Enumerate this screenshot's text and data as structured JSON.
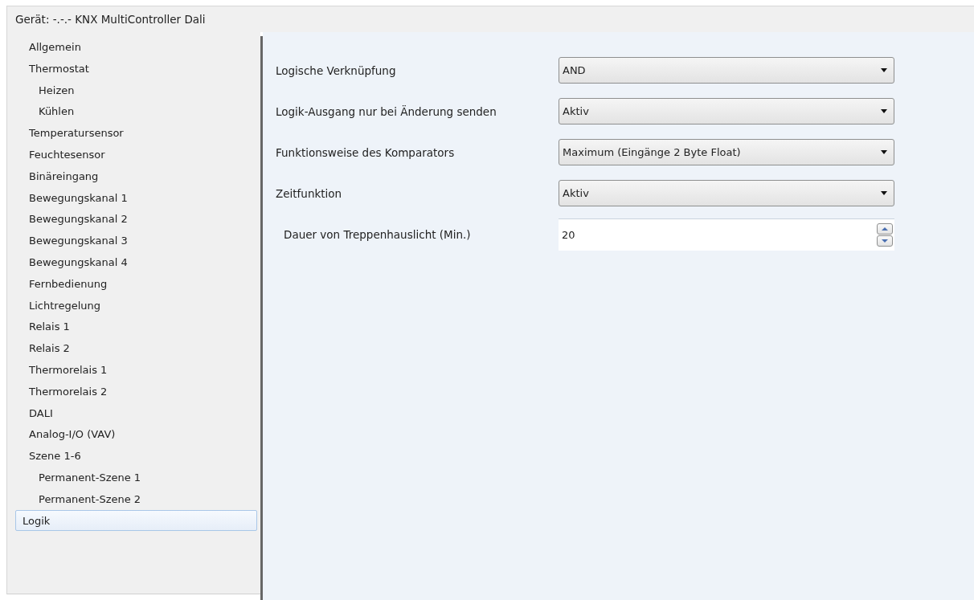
{
  "window": {
    "title": "Gerät: -.-.-  KNX MultiController Dali"
  },
  "sidebar": {
    "items": [
      {
        "label": "Allgemein",
        "selected": false
      },
      {
        "label": "Thermostat",
        "selected": false,
        "children": [
          {
            "label": "Heizen",
            "selected": false
          },
          {
            "label": "Kühlen",
            "selected": false
          }
        ]
      },
      {
        "label": "Temperatursensor",
        "selected": false
      },
      {
        "label": "Feuchtesensor",
        "selected": false
      },
      {
        "label": "Binäreingang",
        "selected": false
      },
      {
        "label": "Bewegungskanal 1",
        "selected": false
      },
      {
        "label": "Bewegungskanal 2",
        "selected": false
      },
      {
        "label": "Bewegungskanal 3",
        "selected": false
      },
      {
        "label": "Bewegungskanal 4",
        "selected": false
      },
      {
        "label": "Fernbedienung",
        "selected": false
      },
      {
        "label": "Lichtregelung",
        "selected": false
      },
      {
        "label": "Relais 1",
        "selected": false
      },
      {
        "label": "Relais 2",
        "selected": false
      },
      {
        "label": "Thermorelais 1",
        "selected": false
      },
      {
        "label": "Thermorelais 2",
        "selected": false
      },
      {
        "label": "DALI",
        "selected": false
      },
      {
        "label": "Analog-I/O (VAV)",
        "selected": false
      },
      {
        "label": "Szene 1-6",
        "selected": false,
        "children": [
          {
            "label": "Permanent-Szene 1",
            "selected": false
          },
          {
            "label": "Permanent-Szene 2",
            "selected": false
          }
        ]
      },
      {
        "label": "Logik",
        "selected": true
      }
    ]
  },
  "parameters": [
    {
      "label": "Logische Verknüpfung",
      "kind": "dropdown",
      "value": "AND"
    },
    {
      "label": "Logik-Ausgang nur bei Änderung senden",
      "kind": "dropdown",
      "value": "Aktiv"
    },
    {
      "label": "Funktionsweise des Komparators",
      "kind": "dropdown",
      "value": "Maximum (Eingänge 2 Byte Float)"
    },
    {
      "label": "Zeitfunktion",
      "kind": "dropdown",
      "value": "Aktiv",
      "children": [
        {
          "label": "Dauer von Treppenhauslicht (Min.)",
          "kind": "spin",
          "value": "20"
        }
      ]
    }
  ]
}
